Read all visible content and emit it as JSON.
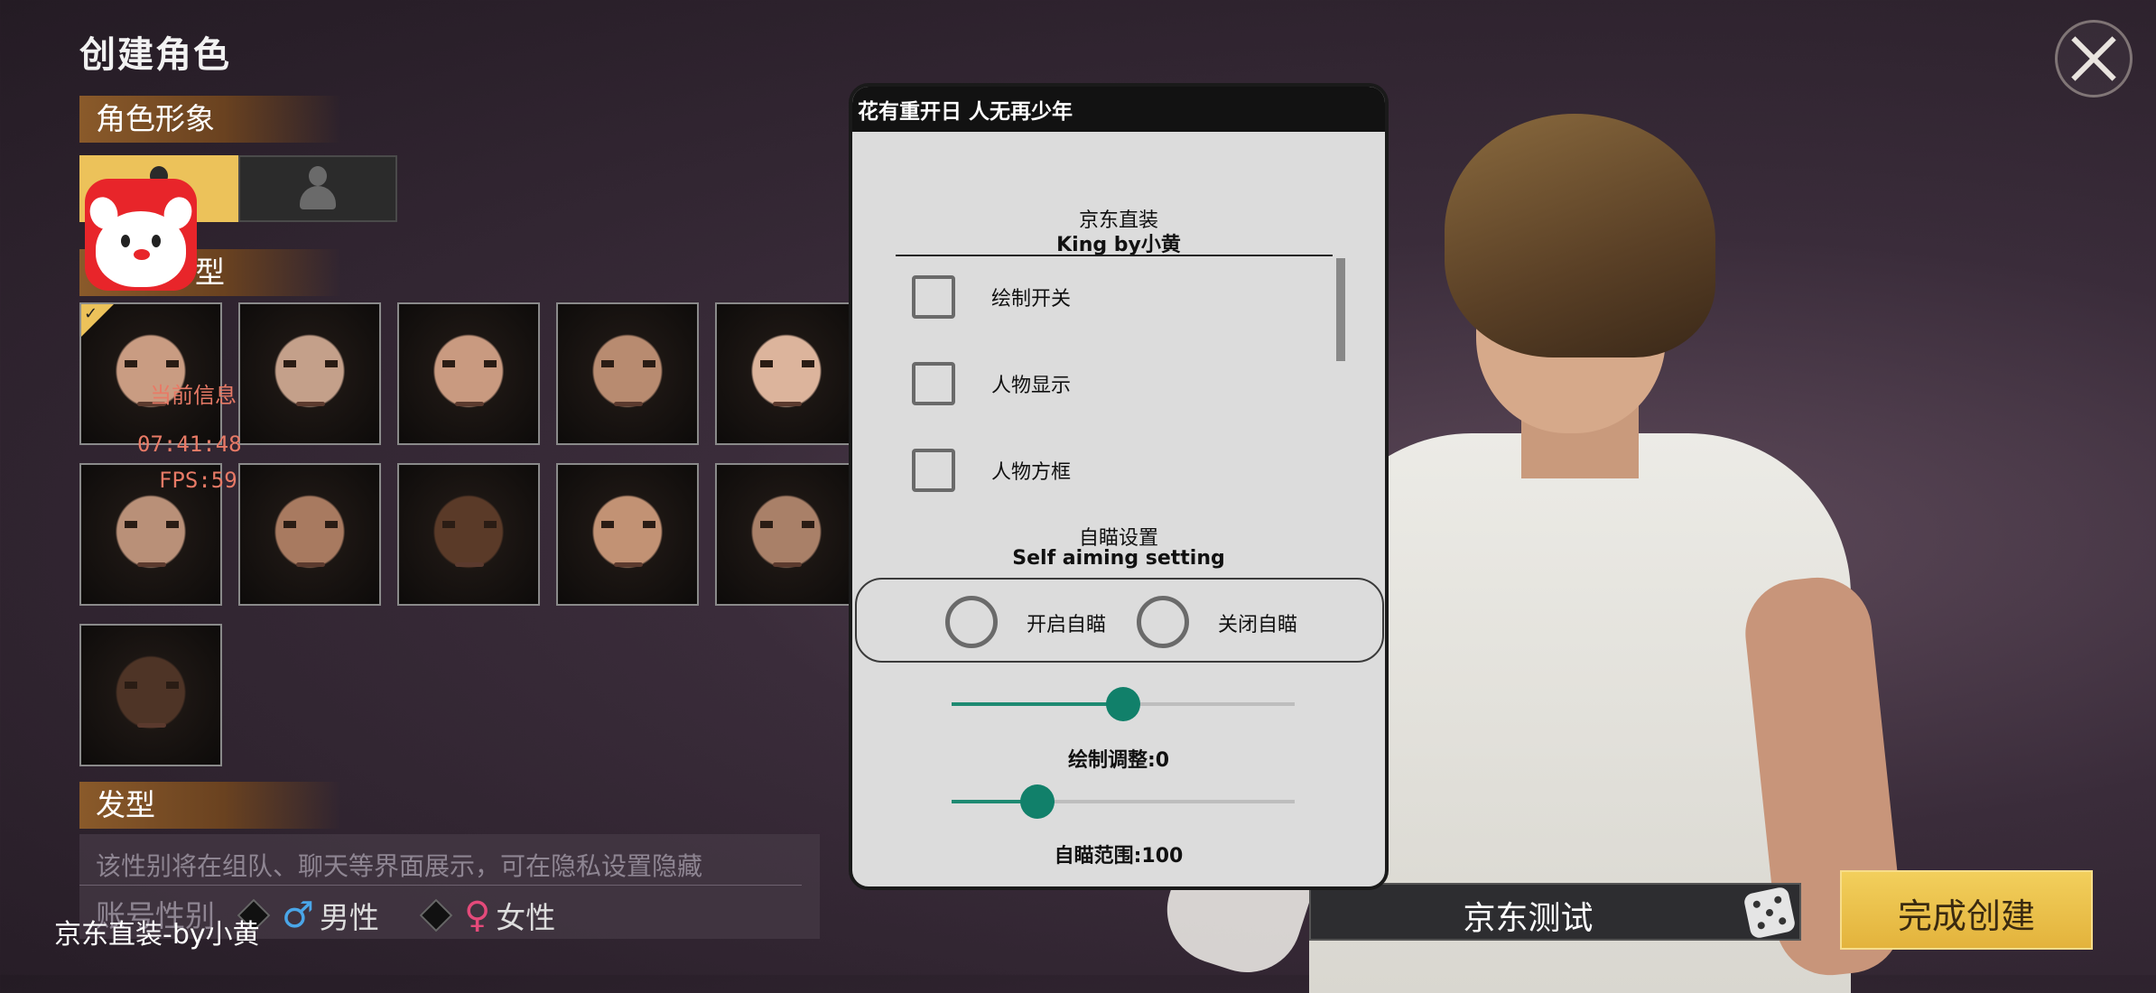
{
  "page": {
    "title": "创建角色",
    "sections": {
      "appearance": "角色形象",
      "face_type": "型",
      "hairstyle": "发型"
    }
  },
  "faces": [
    {
      "skin": "#c99c82",
      "selected": true
    },
    {
      "skin": "#c4a08a",
      "selected": false
    },
    {
      "skin": "#c99a80",
      "selected": false
    },
    {
      "skin": "#b88b70",
      "selected": false
    },
    {
      "skin": "#dcb49c",
      "selected": false
    },
    {
      "skin": "#b99078",
      "selected": false
    },
    {
      "skin": "#a87a60",
      "selected": false
    },
    {
      "skin": "#5a3a28",
      "selected": false
    },
    {
      "skin": "#c29274",
      "selected": false
    },
    {
      "skin": "#a98068",
      "selected": false
    },
    {
      "skin": "#4e3426",
      "selected": false
    }
  ],
  "overlay": {
    "info_label": "当前信息",
    "clock": "07:41:48",
    "fps": "FPS:59"
  },
  "hint": {
    "text": "该性别将在组队、聊天等界面展示，可在隐私设置隐藏",
    "account_gender_label": "账号性别",
    "male": "男性",
    "female": "女性",
    "male_symbol": "♂",
    "female_symbol": "♀"
  },
  "watermark": "京东直装-by小黄",
  "name_field": {
    "value": "京东测试"
  },
  "finish_button": "完成创建",
  "menu": {
    "title": "花有重开日 人无再少年",
    "header_line1": "京东直装",
    "header_line2": "King by小黄",
    "checkboxes": [
      {
        "label": "绘制开关",
        "checked": false
      },
      {
        "label": "人物显示",
        "checked": false
      },
      {
        "label": "人物方框",
        "checked": false
      }
    ],
    "aim_heading_cn": "自瞄设置",
    "aim_heading_en": "Self aiming setting",
    "aim_on": "开启自瞄",
    "aim_off": "关闭自瞄",
    "sliders": [
      {
        "label": "绘制调整:0",
        "fraction": 0.5
      },
      {
        "label": "自瞄范围:100",
        "fraction": 0.25
      }
    ]
  },
  "colors": {
    "accent_gold": "#ecc25a",
    "slider_teal": "#11806a",
    "overlay_red": "#e87a66"
  }
}
